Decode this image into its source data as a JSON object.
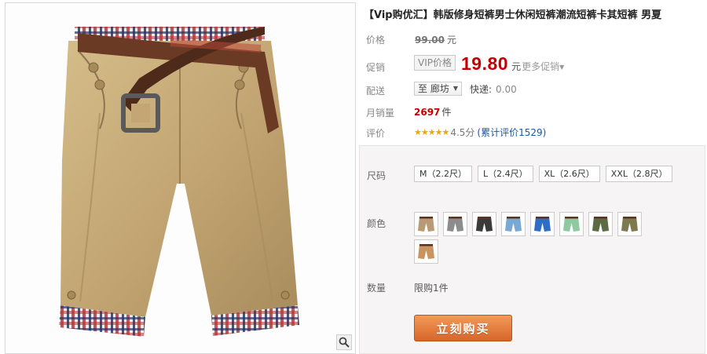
{
  "product": {
    "title": "【Vip购优汇】韩版修身短裤男士休闲短裤潮流短裤卡其短裤 男夏"
  },
  "labels": {
    "price": "价格",
    "promo": "促销",
    "shipping": "配送",
    "monthly_sales": "月销量",
    "reviews": "评价",
    "size": "尺码",
    "color": "颜色",
    "quantity": "数量"
  },
  "price": {
    "original": "99.00",
    "currency": "元",
    "vip_tag": "VIP价格",
    "current": "19.80",
    "more_promo": "更多促销"
  },
  "shipping": {
    "city": "至 廊坊",
    "method": "快递:",
    "fee": "0.00"
  },
  "sales": {
    "count": "2697",
    "unit": "件"
  },
  "rating": {
    "stars_filled": 4.5,
    "score": "4.5分",
    "reviews": "(累计评价1529)"
  },
  "sizes": [
    "M（2.2尺）",
    "L（2.4尺）",
    "XL（2.6尺）",
    "XXL（2.8尺）"
  ],
  "color_swatches": [
    {
      "icon": "khaki-shorts-icon",
      "color": "#b89a74"
    },
    {
      "icon": "grey-shorts-icon",
      "color": "#8c8c8c"
    },
    {
      "icon": "black-shorts-icon",
      "color": "#3a3a3a"
    },
    {
      "icon": "light-blue-shorts-icon",
      "color": "#79a9d2"
    },
    {
      "icon": "blue-shorts-icon",
      "color": "#2f6ec7"
    },
    {
      "icon": "mint-shorts-icon",
      "color": "#8fc9a0"
    },
    {
      "icon": "army-green-shorts-icon",
      "color": "#5c6b44"
    },
    {
      "icon": "olive-shorts-icon",
      "color": "#7c7a4e"
    },
    {
      "icon": "tan-shorts-icon",
      "color": "#c9945f"
    }
  ],
  "quantity": {
    "limit": "限购1件"
  },
  "buy_button": "立刻购买",
  "colors": {
    "price_red": "#c40000",
    "link_blue": "#1a58a5",
    "buy_orange": "#e07a3a",
    "star_gold": "#f0a600"
  }
}
